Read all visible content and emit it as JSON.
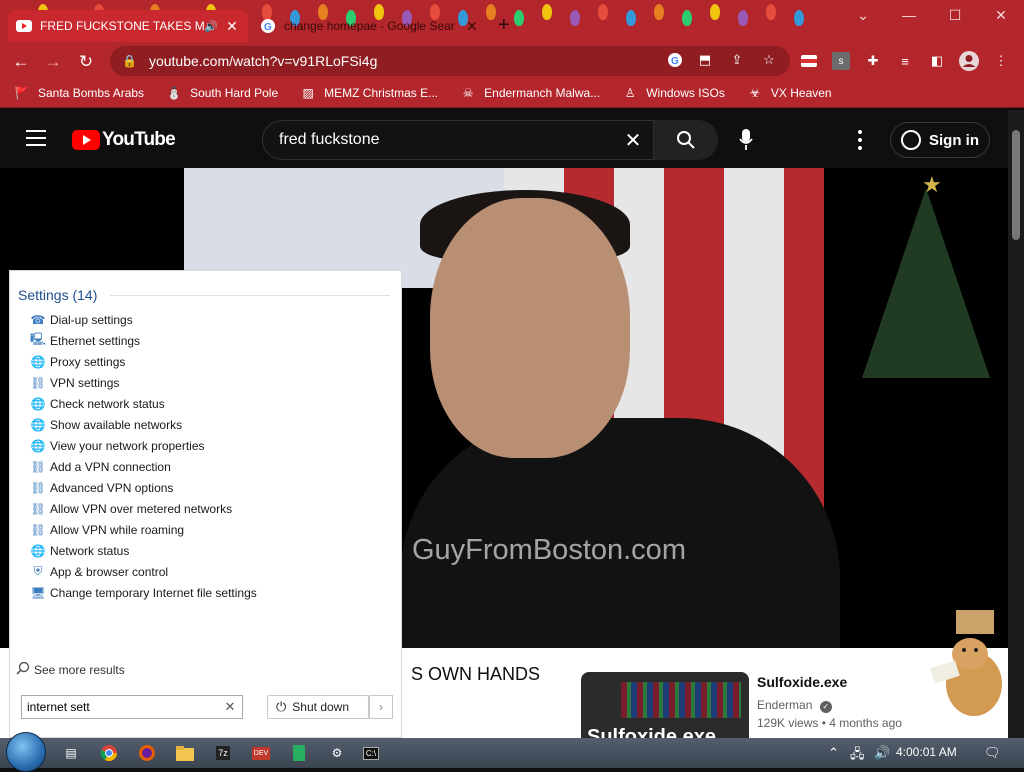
{
  "browser": {
    "tabs": [
      {
        "title": "FRED FUCKSTONE TAKES MA",
        "active": true
      },
      {
        "title": "change homepae - Google Sear",
        "active": false
      }
    ],
    "url": "youtube.com/watch?v=v91RLoFSi4g",
    "bookmarks": [
      {
        "label": "Santa Bombs Arabs",
        "icon": "flag-icon"
      },
      {
        "label": "South Hard Pole",
        "icon": "candy-cane-icon"
      },
      {
        "label": "MEMZ Christmas E...",
        "icon": "image-icon"
      },
      {
        "label": "Endermanch Malwa...",
        "icon": "creature-icon"
      },
      {
        "label": "Windows ISOs",
        "icon": "figure-icon"
      },
      {
        "label": "VX Heaven",
        "icon": "virus-icon"
      }
    ]
  },
  "youtube": {
    "logo_text": "YouTube",
    "search_query": "fred fuckstone",
    "sign_in_label": "Sign in",
    "watermark": "GuyFromBoston.com",
    "video_title_fragment": "S OWN HANDS",
    "recommended": {
      "title": "Sulfoxide.exe",
      "channel": "Enderman",
      "meta": "129K views  •  4 months ago",
      "thumb_text": "Sulfoxide.exe"
    }
  },
  "start_search": {
    "group_heading": "Settings (14)",
    "items": [
      {
        "label": "Dial-up settings",
        "icon": "dialup-icon"
      },
      {
        "label": "Ethernet settings",
        "icon": "ethernet-icon"
      },
      {
        "label": "Proxy settings",
        "icon": "globe-icon"
      },
      {
        "label": "VPN settings",
        "icon": "vpn-icon"
      },
      {
        "label": "Check network status",
        "icon": "globe-icon"
      },
      {
        "label": "Show available networks",
        "icon": "globe-icon"
      },
      {
        "label": "View your network properties",
        "icon": "globe-icon"
      },
      {
        "label": "Add a VPN connection",
        "icon": "vpn-icon"
      },
      {
        "label": "Advanced VPN options",
        "icon": "vpn-icon"
      },
      {
        "label": "Allow VPN over metered networks",
        "icon": "vpn-icon"
      },
      {
        "label": "Allow VPN while roaming",
        "icon": "vpn-icon"
      },
      {
        "label": "Network status",
        "icon": "globe-icon"
      },
      {
        "label": "App & browser control",
        "icon": "shield-icon"
      },
      {
        "label": "Change temporary Internet file settings",
        "icon": "internet-options-icon"
      }
    ],
    "see_more": "See more results",
    "search_text": "internet sett",
    "shutdown_label": "Shut down"
  },
  "taskbar": {
    "clock": "4:00:01 AM"
  }
}
